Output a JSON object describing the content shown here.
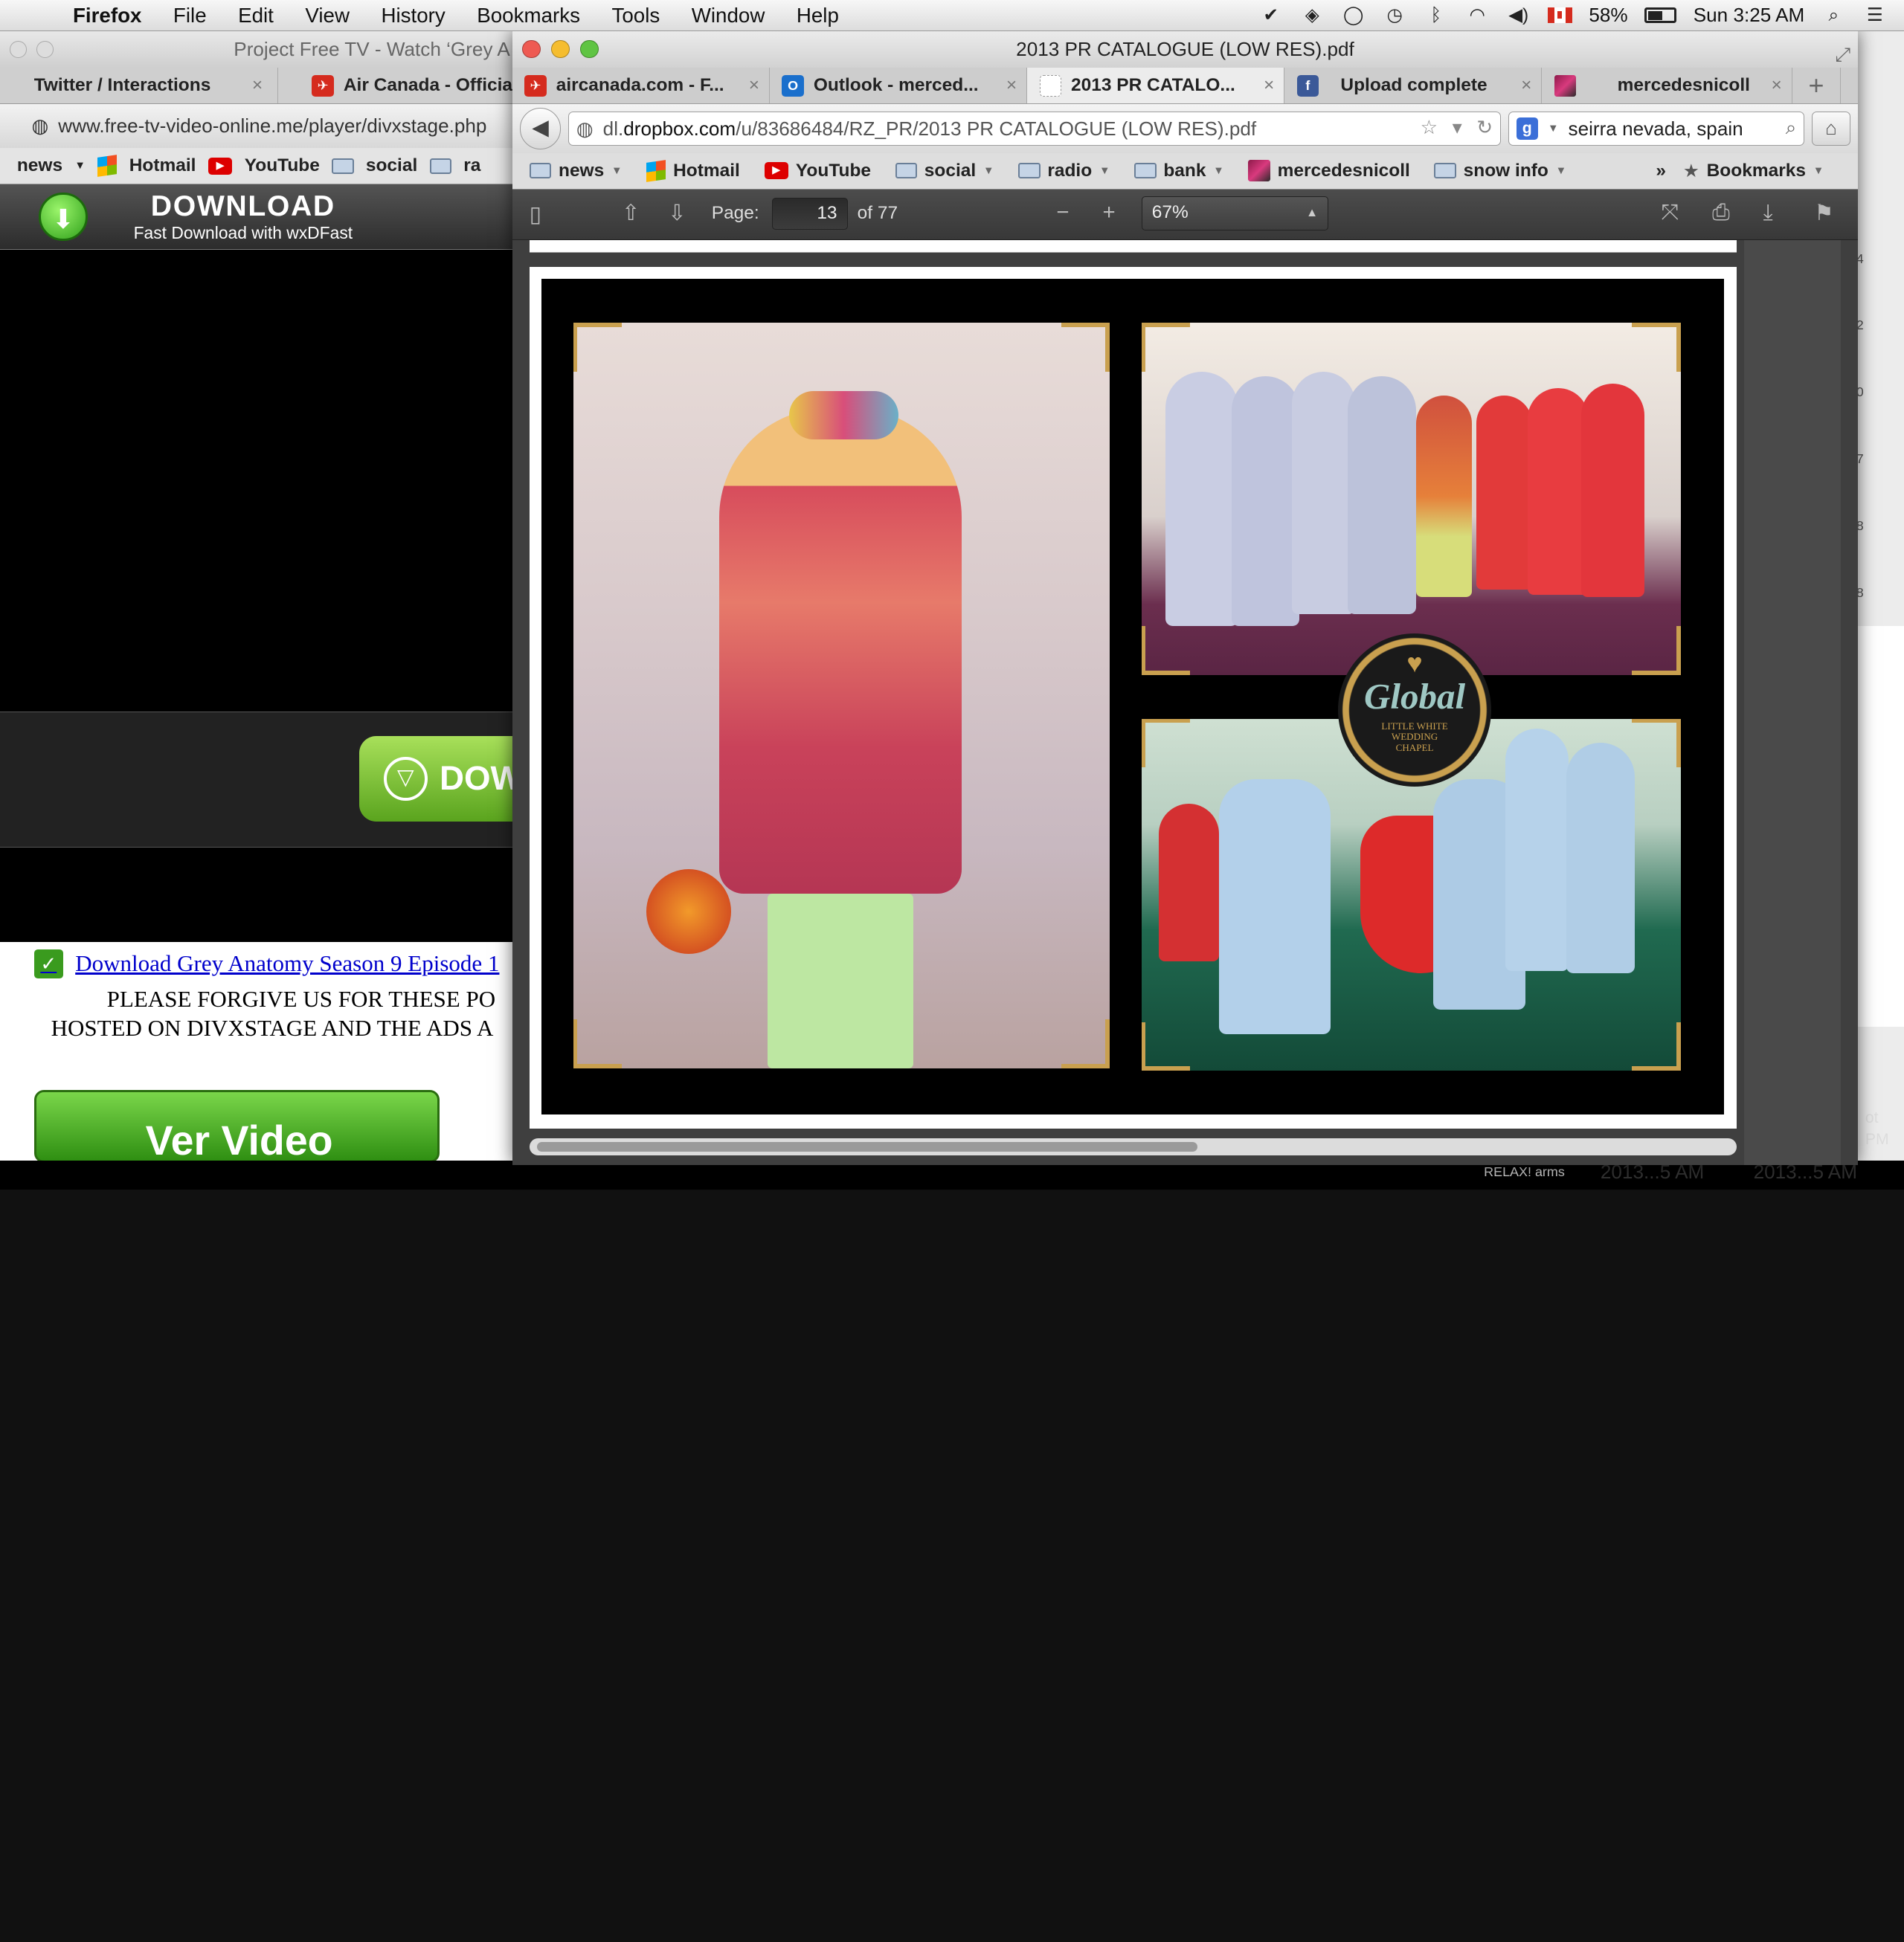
{
  "menubar": {
    "app": "Firefox",
    "items": [
      "File",
      "Edit",
      "View",
      "History",
      "Bookmarks",
      "Tools",
      "Window",
      "Help"
    ],
    "battery": "58%",
    "battery_level": 0.58,
    "clock": "Sun 3:25 AM"
  },
  "back_window": {
    "title": "Project Free TV - Watch ‘Grey A",
    "tabs": [
      {
        "label": "Twitter / Interactions"
      },
      {
        "label": "Air Canada - Official W"
      }
    ],
    "url": "www.free-tv-video-online.me/player/divxstage.php",
    "bookmarks": [
      "news",
      "Hotmail",
      "YouTube",
      "social",
      "ra"
    ],
    "download_title": "DOWNLOAD",
    "download_sub": "Fast Download with wxDFast",
    "dow_button": "DOW",
    "link_text": "Download Grey Anatomy Season 9 Episode 1",
    "line1": "PLEASE FORGIVE US FOR THESE PO",
    "line2": "HOSTED ON DIVXSTAGE AND THE ADS A",
    "ver_video": "Ver Video"
  },
  "right_window": {
    "nums": [
      "4",
      "2",
      "0",
      "7",
      "8",
      "8"
    ]
  },
  "bottom": {
    "relax": "RELAX! arms",
    "ghost1": "2013...5 AM",
    "ghost2": "2013...5 AM",
    "ghost3": "ot",
    "ghost4": "PM"
  },
  "window": {
    "title": "2013 PR CATALOGUE (LOW RES).pdf"
  },
  "tabs": [
    {
      "label": "aircanada.com - F...",
      "icon_color": "#d52b1e",
      "icon_char": "✈"
    },
    {
      "label": "Outlook - merced...",
      "icon_color": "#1a6fcc",
      "icon_char": "O"
    },
    {
      "label": "2013 PR CATALO...",
      "icon_color": "#ffffff",
      "icon_char": ""
    },
    {
      "label": "Upload complete",
      "icon_color": "#3b5998",
      "icon_char": "f"
    },
    {
      "label": "mercedesnicoll",
      "icon_color": "#9b2a5e",
      "icon_char": ""
    }
  ],
  "nav": {
    "url_prefix": "dl.",
    "url_domain": "dropbox.com",
    "url_rest": "/u/83686484/RZ_PR/2013 PR CATALOGUE (LOW RES).pdf",
    "search": "seirra nevada, spain"
  },
  "bookmarks": [
    "news",
    "Hotmail",
    "YouTube",
    "social",
    "radio",
    "bank",
    "mercedesnicoll",
    "snow info"
  ],
  "bookmarks_menu": "Bookmarks",
  "pdf": {
    "page_label": "Page:",
    "page_num": "13",
    "page_total": "of 77",
    "zoom": "67%"
  },
  "badge": {
    "heart": "♥",
    "name": "Global",
    "sub1": "LITTLE WHITE",
    "sub2": "WEDDING",
    "sub3": "CHAPEL"
  }
}
